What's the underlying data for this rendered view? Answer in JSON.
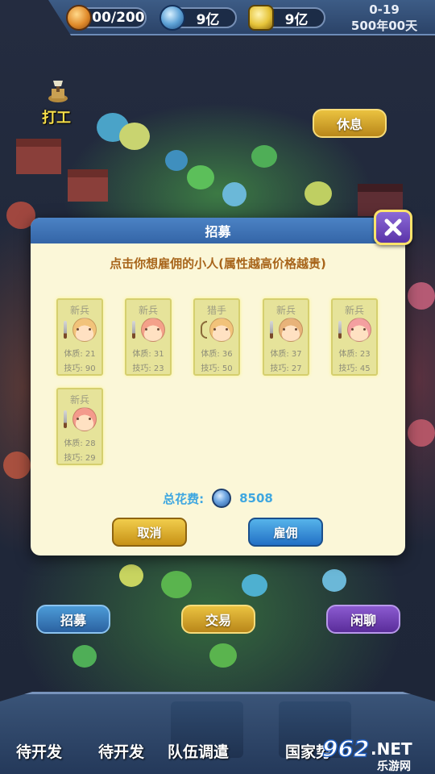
{
  "hud": {
    "energy": "200/200",
    "gems": "9亿",
    "gold": "9亿",
    "date_top": "0-19",
    "date_bottom": "500年00天"
  },
  "world": {
    "work_label": "打工",
    "rest_button": "休息",
    "recruit_button": "招募",
    "trade_button": "交易",
    "chat_button": "闲聊"
  },
  "bottom_nav": {
    "items": [
      "待开发",
      "待开发",
      "队伍调遣",
      "国家势"
    ]
  },
  "watermark": {
    "logo": "962",
    "suffix": ".NET",
    "site": "乐游网"
  },
  "dialog": {
    "title": "招募",
    "instruction": "点击你想雇佣的小人(属性越高价格越贵)",
    "cards": [
      {
        "class": "新兵",
        "stat1": "体质: 21",
        "stat2": "技巧: 90",
        "hair": "#f2c37a",
        "weapon": "sword"
      },
      {
        "class": "新兵",
        "stat1": "体质: 31",
        "stat2": "技巧: 23",
        "hair": "#f4a18a",
        "weapon": "sword"
      },
      {
        "class": "猎手",
        "stat1": "体质: 36",
        "stat2": "技巧: 50",
        "hair": "#f2c37a",
        "weapon": "bow"
      },
      {
        "class": "新兵",
        "stat1": "体质: 37",
        "stat2": "技巧: 27",
        "hair": "#e8b37a",
        "weapon": "sword"
      },
      {
        "class": "新兵",
        "stat1": "体质: 23",
        "stat2": "技巧: 45",
        "hair": "#f4a0a0",
        "weapon": "sword"
      },
      {
        "class": "新兵",
        "stat1": "体质: 28",
        "stat2": "技巧: 29",
        "hair": "#f49a8c",
        "weapon": "sword"
      }
    ],
    "cost_label": "总花费:",
    "cost_value": "8508",
    "cancel_button": "取消",
    "hire_button": "雇佣"
  },
  "colors": {
    "dialog_bg": "#fbf7d8",
    "header_blue": "#3f74b8",
    "instruction": "#a8651b",
    "cost_text": "#3fa7e0",
    "gold_button": "#e2b333",
    "blue_button": "#3a8fd8",
    "purple_button": "#7a4cc2"
  },
  "icons": {
    "energy": "energy-coin-icon",
    "gems": "gem-coin-icon",
    "gold": "gold-ingot-icon",
    "work": "axe-stump-icon",
    "close": "close-x-icon",
    "cost": "gem-coin-icon"
  }
}
